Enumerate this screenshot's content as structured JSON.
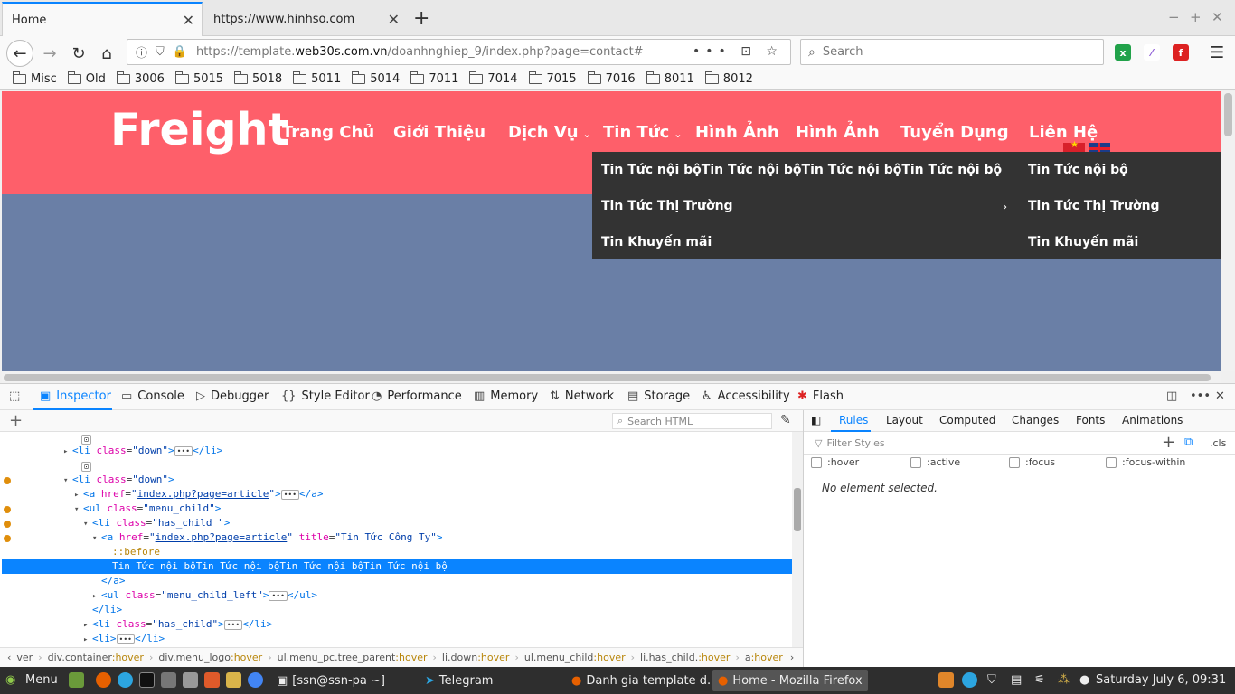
{
  "browser": {
    "tabs": [
      {
        "label": "Home",
        "active": true
      },
      {
        "label": "https://www.hinhso.com",
        "active": false
      }
    ],
    "url_prefix": "https://template.",
    "url_domain": "web30s.com.vn",
    "url_path": "/doanhnghiep_9/index.php?page=contact#",
    "search_placeholder": "Search",
    "bookmarks": [
      "Misc",
      "Old",
      "3006",
      "5015",
      "5018",
      "5011",
      "5014",
      "7011",
      "7014",
      "7015",
      "7016",
      "8011",
      "8012"
    ]
  },
  "site": {
    "logo": "Freight",
    "menu": [
      "Trang Chủ",
      "Giới Thiệu",
      "Dịch Vụ",
      "Tin Tức",
      "Hình Ảnh",
      "Hình Ảnh",
      "Tuyển Dụng",
      "Liên Hệ"
    ],
    "dropdown_left": [
      "Tin Tức nội bộTin Tức nội bộTin Tức nội bộTin Tức nội bộ",
      "Tin Tức Thị Trường",
      "Tin Khuyến mãi"
    ],
    "dropdown_right": [
      "Tin Tức nội bộ",
      "Tin Tức Thị Trường",
      "Tin Khuyến mãi"
    ],
    "hero_color": "#fe5f6a",
    "dropdown_color": "#333333"
  },
  "devtools": {
    "tabs": [
      "Inspector",
      "Console",
      "Debugger",
      "Style Editor",
      "Performance",
      "Memory",
      "Network",
      "Storage",
      "Accessibility",
      "Flash"
    ],
    "active_tab": "Inspector",
    "search_html_placeholder": "Search HTML",
    "markup": {
      "selected_text": "Tin Tức nội bộTin Tức nội bộTin Tức nội bộTin Tức nội bộ",
      "pseudo_before": "::before",
      "href": "index.php?page=article",
      "title_attr": "Tin Tức Công Ty"
    },
    "breadcrumbs": [
      {
        "el": "ver",
        "ps": ""
      },
      {
        "el": "div.container",
        "ps": ":hover"
      },
      {
        "el": "div.menu_logo",
        "ps": ":hover"
      },
      {
        "el": "ul.menu_pc.tree_parent",
        "ps": ":hover"
      },
      {
        "el": "li.down",
        "ps": ":hover"
      },
      {
        "el": "ul.menu_child",
        "ps": ":hover"
      },
      {
        "el": "li.has_child.",
        "ps": ":hover"
      },
      {
        "el": "a",
        "ps": ":hover"
      }
    ],
    "rules_tabs": [
      "Rules",
      "Layout",
      "Computed",
      "Changes",
      "Fonts",
      "Animations"
    ],
    "filter_placeholder": "Filter Styles",
    "cls_label": ".cls",
    "pseudo_classes": [
      ":hover",
      ":active",
      ":focus",
      ":focus-within"
    ],
    "no_element": "No element selected."
  },
  "taskbar": {
    "menu_label": "Menu",
    "windows": [
      {
        "label": "[ssn@ssn-pa ~]",
        "active": false
      },
      {
        "label": "Telegram",
        "active": false
      },
      {
        "label": "Danh gia template d...",
        "active": false
      },
      {
        "label": "Home - Mozilla Firefox",
        "active": true
      }
    ],
    "clock": "Saturday July  6, 09:31"
  }
}
